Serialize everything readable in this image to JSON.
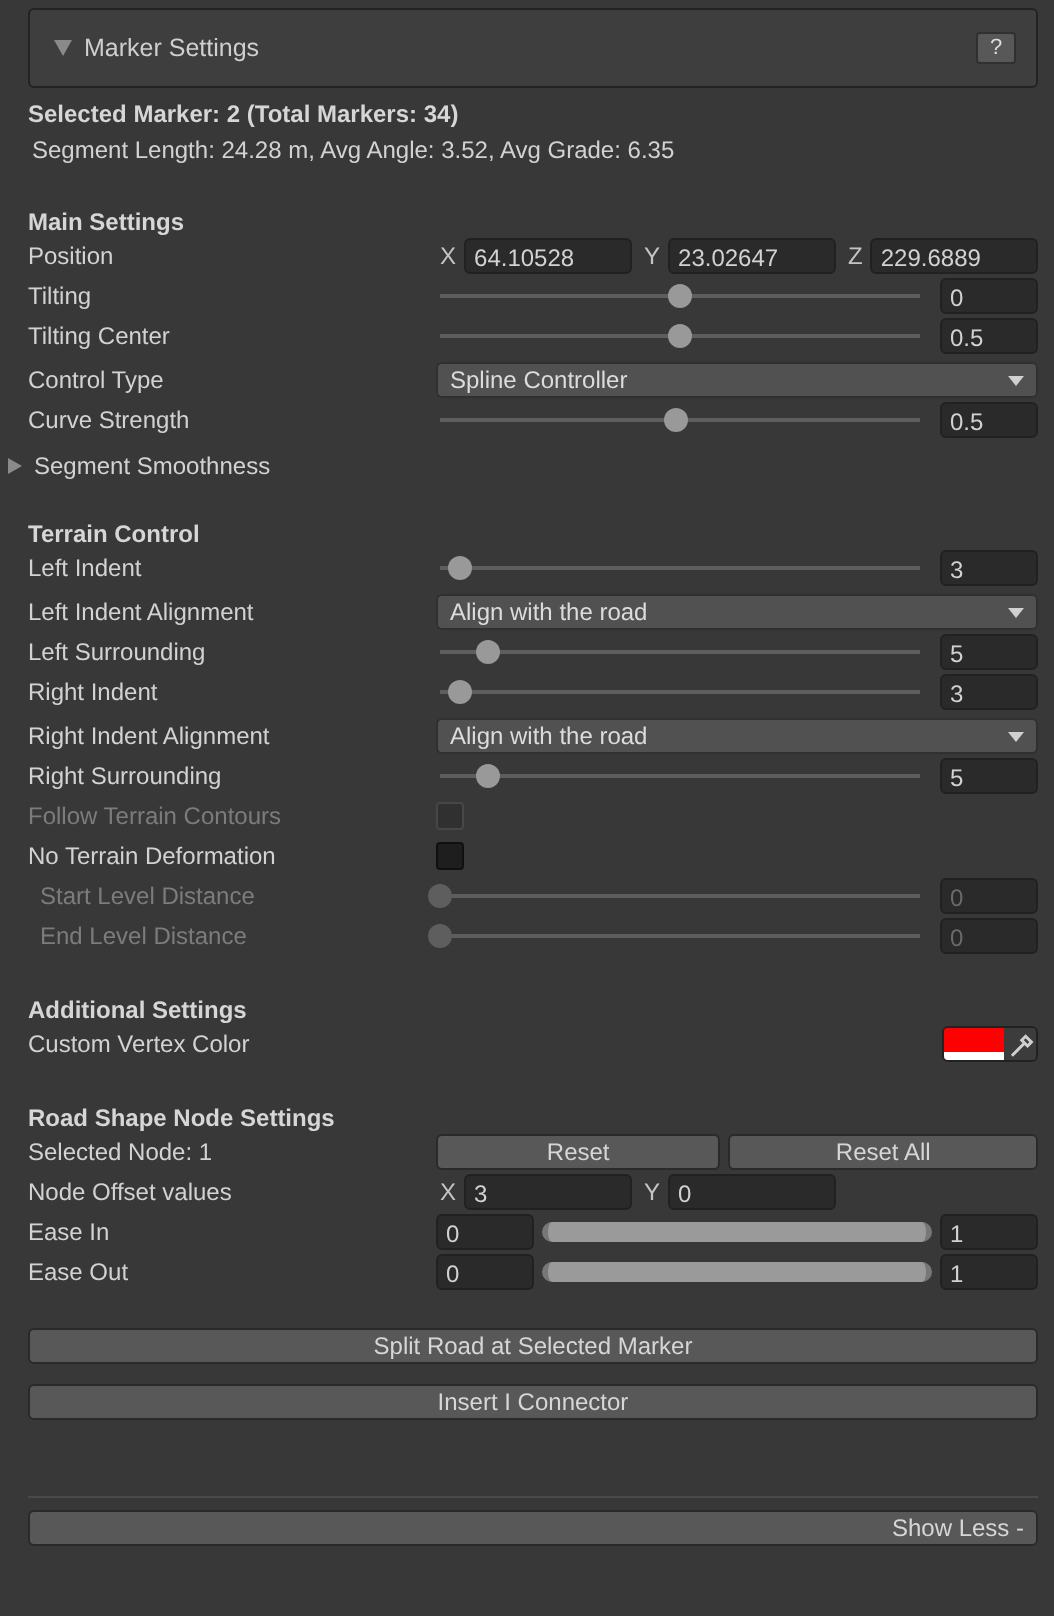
{
  "header": {
    "title": "Marker Settings",
    "help": "?",
    "expanded": true
  },
  "summary": {
    "selected": "Selected Marker: 2  (Total Markers: 34)",
    "stats": "Segment Length: 24.28 m, Avg Angle: 3.52, Avg Grade: 6.35"
  },
  "sections": [
    {
      "title": "Main Settings",
      "rows": [
        {
          "kind": "vector",
          "label": "Position",
          "fields": [
            {
              "axis": "X",
              "value": "64.10528"
            },
            {
              "axis": "Y",
              "value": "23.02647"
            },
            {
              "axis": "Z",
              "value": "229.6889"
            }
          ]
        },
        {
          "kind": "slider",
          "label": "Tilting",
          "level": 0.5,
          "value": "0",
          "disabled": false
        },
        {
          "kind": "slider",
          "label": "Tilting Center",
          "level": 0.5,
          "value": "0.5",
          "disabled": false
        },
        {
          "kind": "dropdown",
          "label": "Control Type",
          "value": "Spline Controller"
        },
        {
          "kind": "slider",
          "label": "Curve Strength",
          "level": 0.49,
          "value": "0.5",
          "disabled": false
        },
        {
          "kind": "foldout",
          "label": "Segment Smoothness",
          "expanded": false
        }
      ]
    },
    {
      "title": "Terrain Control",
      "rows": [
        {
          "kind": "slider",
          "label": "Left Indent",
          "level": 0.04,
          "value": "3",
          "disabled": false
        },
        {
          "kind": "dropdown",
          "label": "Left Indent Alignment",
          "value": "Align with the road"
        },
        {
          "kind": "slider",
          "label": "Left Surrounding",
          "level": 0.1,
          "value": "5",
          "disabled": false
        },
        {
          "kind": "slider",
          "label": "Right Indent",
          "level": 0.04,
          "value": "3",
          "disabled": false
        },
        {
          "kind": "dropdown",
          "label": "Right Indent Alignment",
          "value": "Align with the road"
        },
        {
          "kind": "slider",
          "label": "Right Surrounding",
          "level": 0.1,
          "value": "5",
          "disabled": false
        },
        {
          "kind": "checkbox",
          "label": "Follow Terrain Contours",
          "checked": false,
          "disabled": true
        },
        {
          "kind": "checkbox",
          "label": "No Terrain Deformation",
          "checked": false,
          "disabled": false,
          "children": [
            {
              "kind": "slider",
              "label": "Start Level Distance",
              "level": 0,
              "value": "0",
              "disabled": true
            },
            {
              "kind": "slider",
              "label": "End Level Distance",
              "level": 0,
              "value": "0",
              "disabled": true
            }
          ]
        }
      ]
    },
    {
      "title": "Additional Settings",
      "rows": [
        {
          "kind": "color",
          "label": "Custom Vertex Color",
          "color": "#ff0000"
        }
      ]
    },
    {
      "title": "Road Shape Node Settings",
      "rows": [
        {
          "kind": "buttons",
          "label": "Selected Node: 1",
          "buttons": [
            "Reset",
            "Reset All"
          ]
        },
        {
          "kind": "vector",
          "label": "Node Offset values",
          "fields": [
            {
              "axis": "X",
              "value": "3"
            },
            {
              "axis": "Y",
              "value": "0"
            }
          ]
        },
        {
          "kind": "range",
          "label": "Ease In",
          "min": "0",
          "max": "1"
        },
        {
          "kind": "range",
          "label": "Ease Out",
          "min": "0",
          "max": "1"
        }
      ]
    }
  ],
  "actions": [
    "Split Road at Selected Marker",
    "Insert I Connector"
  ],
  "footer_button": "Show Less -"
}
